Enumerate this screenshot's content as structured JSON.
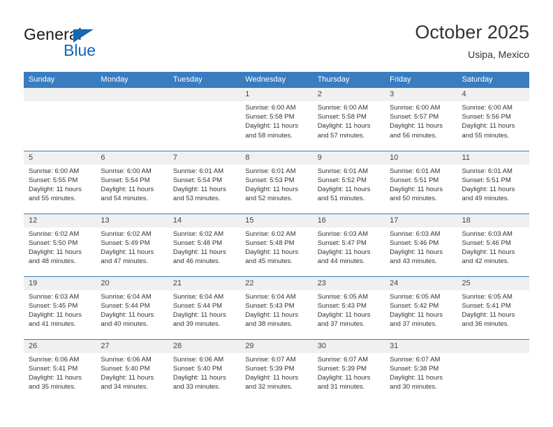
{
  "brand": {
    "name_top": "General",
    "name_bottom": "Blue",
    "flag_color": "#1268b3"
  },
  "header": {
    "title": "October 2025",
    "subtitle": "Usipa, Mexico",
    "accent_color": "#3a7cc0",
    "daynum_bg": "#f0f0f0"
  },
  "weekday_headers": [
    "Sunday",
    "Monday",
    "Tuesday",
    "Wednesday",
    "Thursday",
    "Friday",
    "Saturday"
  ],
  "weeks": [
    [
      {
        "day": "",
        "sunrise": "",
        "sunset": "",
        "daylight_1": "",
        "daylight_2": ""
      },
      {
        "day": "",
        "sunrise": "",
        "sunset": "",
        "daylight_1": "",
        "daylight_2": ""
      },
      {
        "day": "",
        "sunrise": "",
        "sunset": "",
        "daylight_1": "",
        "daylight_2": ""
      },
      {
        "day": "1",
        "sunrise": "Sunrise: 6:00 AM",
        "sunset": "Sunset: 5:58 PM",
        "daylight_1": "Daylight: 11 hours",
        "daylight_2": "and 58 minutes."
      },
      {
        "day": "2",
        "sunrise": "Sunrise: 6:00 AM",
        "sunset": "Sunset: 5:58 PM",
        "daylight_1": "Daylight: 11 hours",
        "daylight_2": "and 57 minutes."
      },
      {
        "day": "3",
        "sunrise": "Sunrise: 6:00 AM",
        "sunset": "Sunset: 5:57 PM",
        "daylight_1": "Daylight: 11 hours",
        "daylight_2": "and 56 minutes."
      },
      {
        "day": "4",
        "sunrise": "Sunrise: 6:00 AM",
        "sunset": "Sunset: 5:56 PM",
        "daylight_1": "Daylight: 11 hours",
        "daylight_2": "and 55 minutes."
      }
    ],
    [
      {
        "day": "5",
        "sunrise": "Sunrise: 6:00 AM",
        "sunset": "Sunset: 5:55 PM",
        "daylight_1": "Daylight: 11 hours",
        "daylight_2": "and 55 minutes."
      },
      {
        "day": "6",
        "sunrise": "Sunrise: 6:00 AM",
        "sunset": "Sunset: 5:54 PM",
        "daylight_1": "Daylight: 11 hours",
        "daylight_2": "and 54 minutes."
      },
      {
        "day": "7",
        "sunrise": "Sunrise: 6:01 AM",
        "sunset": "Sunset: 5:54 PM",
        "daylight_1": "Daylight: 11 hours",
        "daylight_2": "and 53 minutes."
      },
      {
        "day": "8",
        "sunrise": "Sunrise: 6:01 AM",
        "sunset": "Sunset: 5:53 PM",
        "daylight_1": "Daylight: 11 hours",
        "daylight_2": "and 52 minutes."
      },
      {
        "day": "9",
        "sunrise": "Sunrise: 6:01 AM",
        "sunset": "Sunset: 5:52 PM",
        "daylight_1": "Daylight: 11 hours",
        "daylight_2": "and 51 minutes."
      },
      {
        "day": "10",
        "sunrise": "Sunrise: 6:01 AM",
        "sunset": "Sunset: 5:51 PM",
        "daylight_1": "Daylight: 11 hours",
        "daylight_2": "and 50 minutes."
      },
      {
        "day": "11",
        "sunrise": "Sunrise: 6:01 AM",
        "sunset": "Sunset: 5:51 PM",
        "daylight_1": "Daylight: 11 hours",
        "daylight_2": "and 49 minutes."
      }
    ],
    [
      {
        "day": "12",
        "sunrise": "Sunrise: 6:02 AM",
        "sunset": "Sunset: 5:50 PM",
        "daylight_1": "Daylight: 11 hours",
        "daylight_2": "and 48 minutes."
      },
      {
        "day": "13",
        "sunrise": "Sunrise: 6:02 AM",
        "sunset": "Sunset: 5:49 PM",
        "daylight_1": "Daylight: 11 hours",
        "daylight_2": "and 47 minutes."
      },
      {
        "day": "14",
        "sunrise": "Sunrise: 6:02 AM",
        "sunset": "Sunset: 5:48 PM",
        "daylight_1": "Daylight: 11 hours",
        "daylight_2": "and 46 minutes."
      },
      {
        "day": "15",
        "sunrise": "Sunrise: 6:02 AM",
        "sunset": "Sunset: 5:48 PM",
        "daylight_1": "Daylight: 11 hours",
        "daylight_2": "and 45 minutes."
      },
      {
        "day": "16",
        "sunrise": "Sunrise: 6:03 AM",
        "sunset": "Sunset: 5:47 PM",
        "daylight_1": "Daylight: 11 hours",
        "daylight_2": "and 44 minutes."
      },
      {
        "day": "17",
        "sunrise": "Sunrise: 6:03 AM",
        "sunset": "Sunset: 5:46 PM",
        "daylight_1": "Daylight: 11 hours",
        "daylight_2": "and 43 minutes."
      },
      {
        "day": "18",
        "sunrise": "Sunrise: 6:03 AM",
        "sunset": "Sunset: 5:46 PM",
        "daylight_1": "Daylight: 11 hours",
        "daylight_2": "and 42 minutes."
      }
    ],
    [
      {
        "day": "19",
        "sunrise": "Sunrise: 6:03 AM",
        "sunset": "Sunset: 5:45 PM",
        "daylight_1": "Daylight: 11 hours",
        "daylight_2": "and 41 minutes."
      },
      {
        "day": "20",
        "sunrise": "Sunrise: 6:04 AM",
        "sunset": "Sunset: 5:44 PM",
        "daylight_1": "Daylight: 11 hours",
        "daylight_2": "and 40 minutes."
      },
      {
        "day": "21",
        "sunrise": "Sunrise: 6:04 AM",
        "sunset": "Sunset: 5:44 PM",
        "daylight_1": "Daylight: 11 hours",
        "daylight_2": "and 39 minutes."
      },
      {
        "day": "22",
        "sunrise": "Sunrise: 6:04 AM",
        "sunset": "Sunset: 5:43 PM",
        "daylight_1": "Daylight: 11 hours",
        "daylight_2": "and 38 minutes."
      },
      {
        "day": "23",
        "sunrise": "Sunrise: 6:05 AM",
        "sunset": "Sunset: 5:43 PM",
        "daylight_1": "Daylight: 11 hours",
        "daylight_2": "and 37 minutes."
      },
      {
        "day": "24",
        "sunrise": "Sunrise: 6:05 AM",
        "sunset": "Sunset: 5:42 PM",
        "daylight_1": "Daylight: 11 hours",
        "daylight_2": "and 37 minutes."
      },
      {
        "day": "25",
        "sunrise": "Sunrise: 6:05 AM",
        "sunset": "Sunset: 5:41 PM",
        "daylight_1": "Daylight: 11 hours",
        "daylight_2": "and 36 minutes."
      }
    ],
    [
      {
        "day": "26",
        "sunrise": "Sunrise: 6:06 AM",
        "sunset": "Sunset: 5:41 PM",
        "daylight_1": "Daylight: 11 hours",
        "daylight_2": "and 35 minutes."
      },
      {
        "day": "27",
        "sunrise": "Sunrise: 6:06 AM",
        "sunset": "Sunset: 5:40 PM",
        "daylight_1": "Daylight: 11 hours",
        "daylight_2": "and 34 minutes."
      },
      {
        "day": "28",
        "sunrise": "Sunrise: 6:06 AM",
        "sunset": "Sunset: 5:40 PM",
        "daylight_1": "Daylight: 11 hours",
        "daylight_2": "and 33 minutes."
      },
      {
        "day": "29",
        "sunrise": "Sunrise: 6:07 AM",
        "sunset": "Sunset: 5:39 PM",
        "daylight_1": "Daylight: 11 hours",
        "daylight_2": "and 32 minutes."
      },
      {
        "day": "30",
        "sunrise": "Sunrise: 6:07 AM",
        "sunset": "Sunset: 5:39 PM",
        "daylight_1": "Daylight: 11 hours",
        "daylight_2": "and 31 minutes."
      },
      {
        "day": "31",
        "sunrise": "Sunrise: 6:07 AM",
        "sunset": "Sunset: 5:38 PM",
        "daylight_1": "Daylight: 11 hours",
        "daylight_2": "and 30 minutes."
      },
      {
        "day": "",
        "sunrise": "",
        "sunset": "",
        "daylight_1": "",
        "daylight_2": ""
      }
    ]
  ]
}
